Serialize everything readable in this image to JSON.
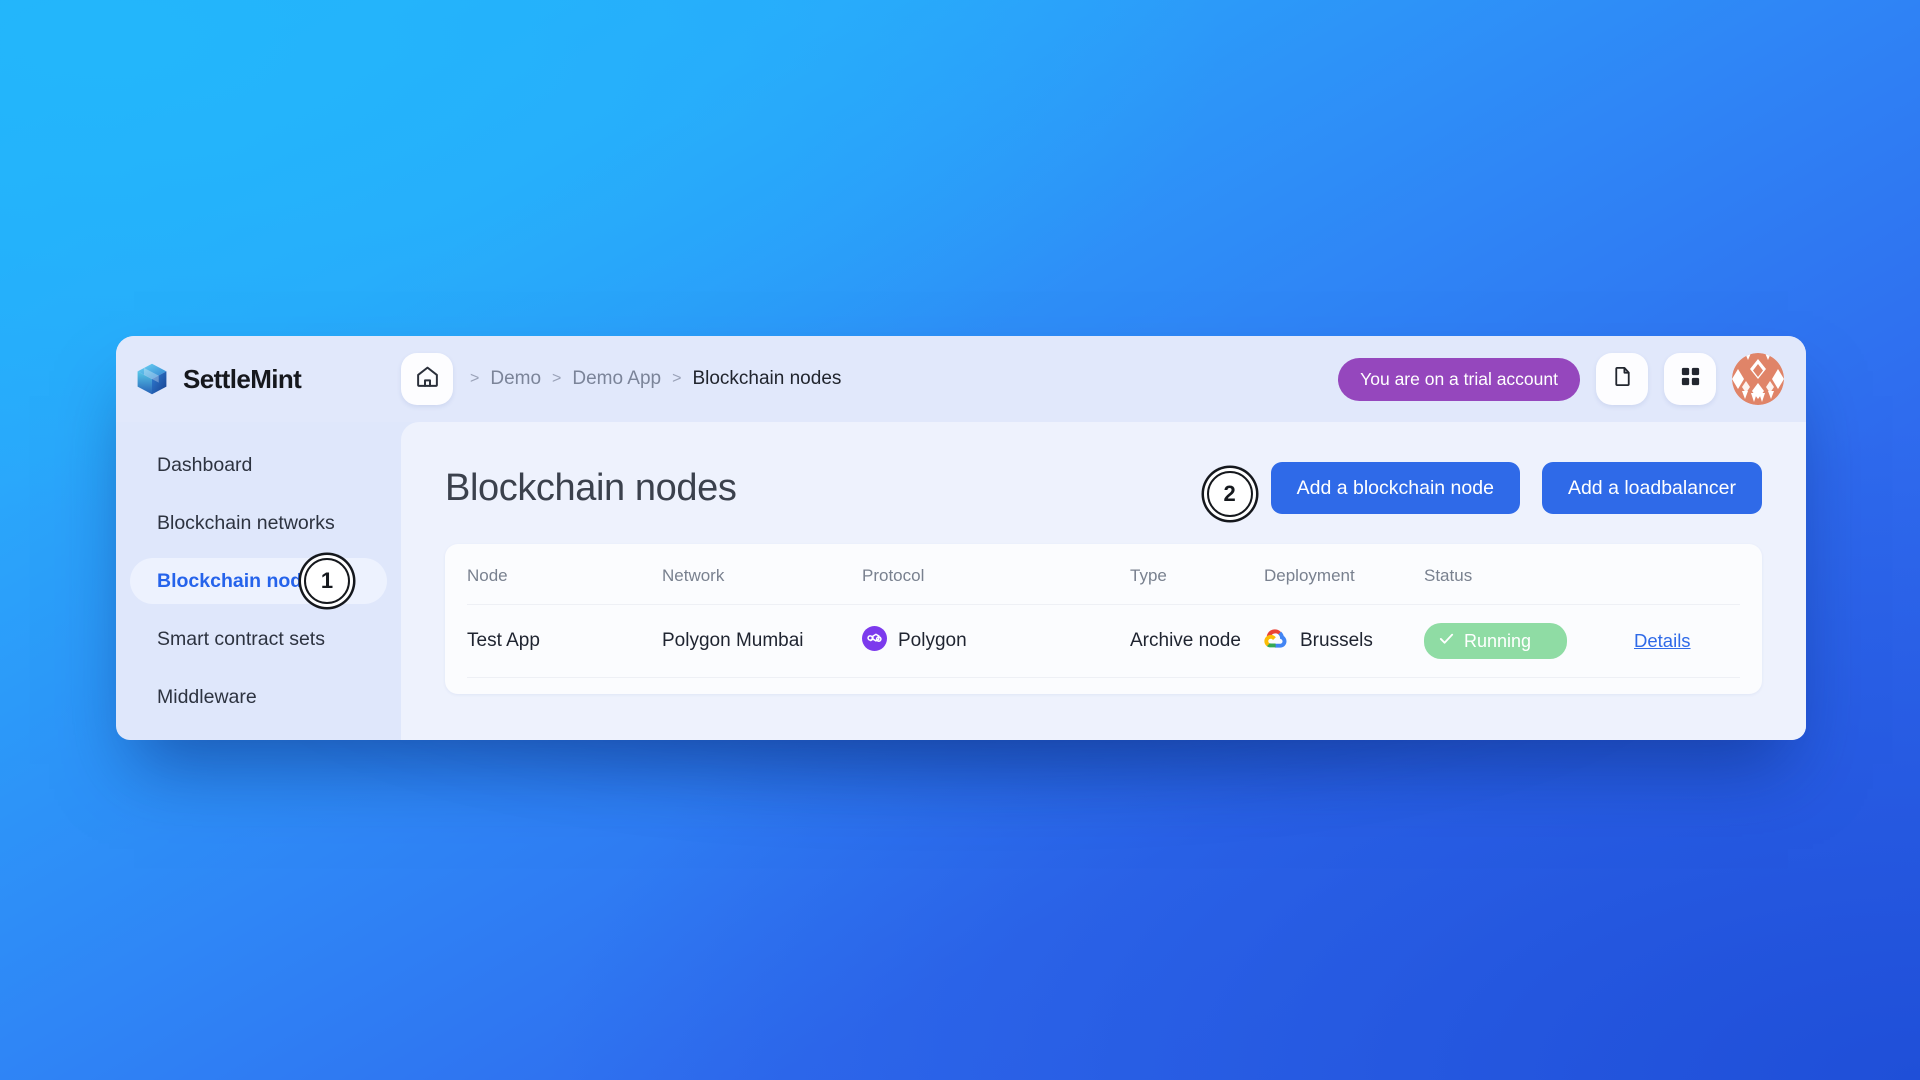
{
  "brand": {
    "name": "SettleMint",
    "logo_icon": "cube-logo-icon"
  },
  "topbar": {
    "home_icon": "home-icon",
    "breadcrumb": {
      "separator": ">",
      "items": [
        {
          "label": "Demo",
          "current": false
        },
        {
          "label": "Demo App",
          "current": false
        },
        {
          "label": "Blockchain nodes",
          "current": true
        }
      ]
    },
    "trial_badge": "You are on a trial account",
    "trial_badge_color": "#9547bd",
    "doc_icon": "document-icon",
    "apps_icon": "grid-apps-icon",
    "avatar_icon": "user-avatar-identicon"
  },
  "sidebar": {
    "items": [
      {
        "label": "Dashboard",
        "active": false
      },
      {
        "label": "Blockchain networks",
        "active": false
      },
      {
        "label": "Blockchain nodes",
        "active": true,
        "annotation": "1"
      },
      {
        "label": "Smart contract sets",
        "active": false
      },
      {
        "label": "Middleware",
        "active": false
      }
    ]
  },
  "main": {
    "page_title": "Blockchain nodes",
    "annotation_2": "2",
    "buttons": [
      {
        "label": "Add a blockchain node"
      },
      {
        "label": "Add a loadbalancer"
      }
    ],
    "accent_color": "#2f6ae8",
    "table": {
      "columns": [
        "Node",
        "Network",
        "Protocol",
        "Type",
        "Deployment",
        "Status",
        ""
      ],
      "rows": [
        {
          "node": "Test App",
          "network": "Polygon Mumbai",
          "protocol": "Polygon",
          "protocol_icon": "polygon-icon",
          "type": "Archive node",
          "deployment": "Brussels",
          "deployment_icon": "google-cloud-icon",
          "status": "Running",
          "status_icon": "check-icon",
          "status_color": "#8fdca4",
          "action": "Details"
        }
      ]
    }
  }
}
